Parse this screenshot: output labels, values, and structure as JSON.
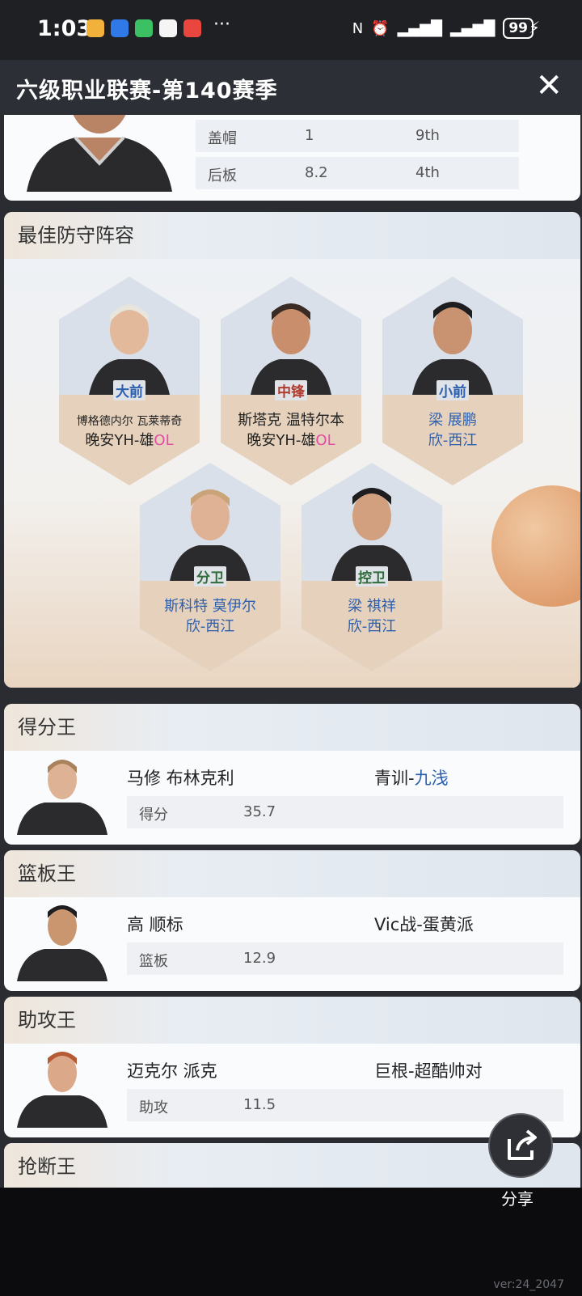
{
  "status_bar": {
    "time": "1:03",
    "more": "···",
    "battery": "99",
    "nfc_icon": "nfc-icon",
    "alarm_icon": "alarm-icon"
  },
  "titlebar": {
    "title": "六级职业联赛-第140赛季",
    "close_glyph": "✕"
  },
  "top_stats": [
    {
      "label": "盖帽",
      "value": "1",
      "rank": "9th"
    },
    {
      "label": "后板",
      "value": "8.2",
      "rank": "4th"
    }
  ],
  "defense": {
    "title": "最佳防守阵容",
    "players": [
      {
        "position": "大前",
        "name": "博格德内尔 瓦莱蒂奇",
        "team_prefix": "晚安YH-雄",
        "team_suffix": "OL"
      },
      {
        "position": "中锋",
        "name": "斯塔克 温特尔本",
        "team_prefix": "晚安YH-雄",
        "team_suffix": "OL"
      },
      {
        "position": "小前",
        "name": "梁 展鹏",
        "team": "欣-西江"
      },
      {
        "position": "分卫",
        "name": "斯科特 莫伊尔",
        "team": "欣-西江"
      },
      {
        "position": "控卫",
        "name": "梁 祺祥",
        "team": "欣-西江"
      }
    ]
  },
  "leaders": [
    {
      "title": "得分王",
      "name": "马修 布林克利",
      "team_prefix": "青训-",
      "team_suffix": "九浅",
      "stat_label": "得分",
      "stat_value": "35.7"
    },
    {
      "title": "篮板王",
      "name": "高 顺标",
      "team": "Vic战-蛋黄派",
      "stat_label": "篮板",
      "stat_value": "12.9"
    },
    {
      "title": "助攻王",
      "name": "迈克尔 派克",
      "team": "巨根-超酷帅对",
      "stat_label": "助攻",
      "stat_value": "11.5"
    },
    {
      "title": "抢断王"
    }
  ],
  "share": {
    "label": "分享"
  },
  "version": "ver:24_2047",
  "colors": {
    "accent_blue": "#2c5fae",
    "ol_pink": "#e24da6",
    "center_red": "#b23b2e"
  }
}
